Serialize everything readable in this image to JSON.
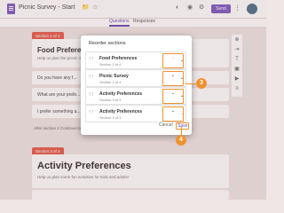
{
  "topbar": {
    "title": "Picnic Survey - Start",
    "send_label": "Send"
  },
  "tabs": [
    "Questions",
    "Responses"
  ],
  "form": {
    "section2_tag": "Section 2 of 4",
    "section2_title": "Food Preferences",
    "section2_desc": "Help us plan the picnic menu",
    "questions": [
      "Do you have any f...",
      "What are your prefe...",
      "I prefer something a..."
    ],
    "after_section": "After section 2   Continue to next section",
    "section3_tag": "Section 3 of 4",
    "section3_title": "Activity Preferences",
    "section3_desc": "Help us plan some fun activities for Kids and adults!"
  },
  "dialog": {
    "title": "Reorder sections",
    "items": [
      {
        "title": "Food Preferences",
        "sub": "Section 1 of 4"
      },
      {
        "title": "Picnic Survey",
        "sub": "Section 2 of 4"
      },
      {
        "title": "Activity Preferences",
        "sub": "Section 3 of 4"
      },
      {
        "title": "Activity Preferences",
        "sub": "Section 4 of 4"
      }
    ],
    "cancel_label": "Cancel",
    "save_label": "Save"
  },
  "callouts": {
    "step3": "3",
    "step4": "4"
  },
  "colors": {
    "accent": "#7b57c1",
    "section_tag": "#e45a4a",
    "callout": "#f0922e"
  }
}
